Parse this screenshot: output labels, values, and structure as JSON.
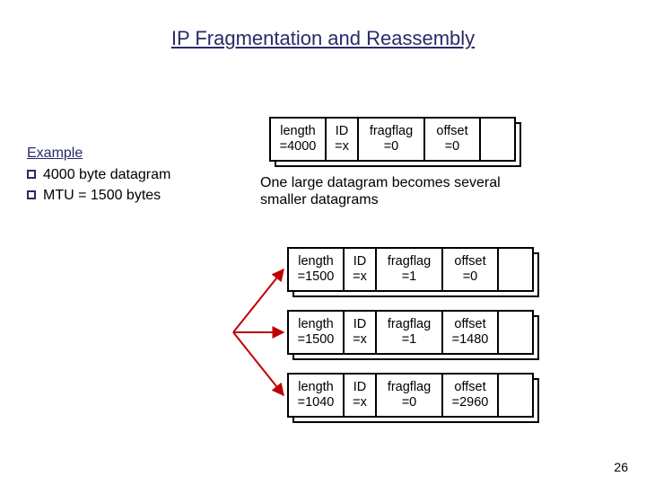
{
  "title": "IP Fragmentation and Reassembly",
  "example": {
    "heading": "Example",
    "bullets": [
      "4000 byte datagram",
      "MTU = 1500 bytes"
    ]
  },
  "caption": "One large datagram becomes several smaller datagrams",
  "headers": {
    "length": "length",
    "id": "ID",
    "fragflag": "fragflag",
    "offset": "offset"
  },
  "datagrams": {
    "original": {
      "length": "=4000",
      "id": "=x",
      "fragflag": "=0",
      "offset": "=0"
    },
    "frags": [
      {
        "length": "=1500",
        "id": "=x",
        "fragflag": "=1",
        "offset": "=0"
      },
      {
        "length": "=1500",
        "id": "=x",
        "fragflag": "=1",
        "offset": "=1480"
      },
      {
        "length": "=1040",
        "id": "=x",
        "fragflag": "=0",
        "offset": "=2960"
      }
    ]
  },
  "page_number": "26"
}
